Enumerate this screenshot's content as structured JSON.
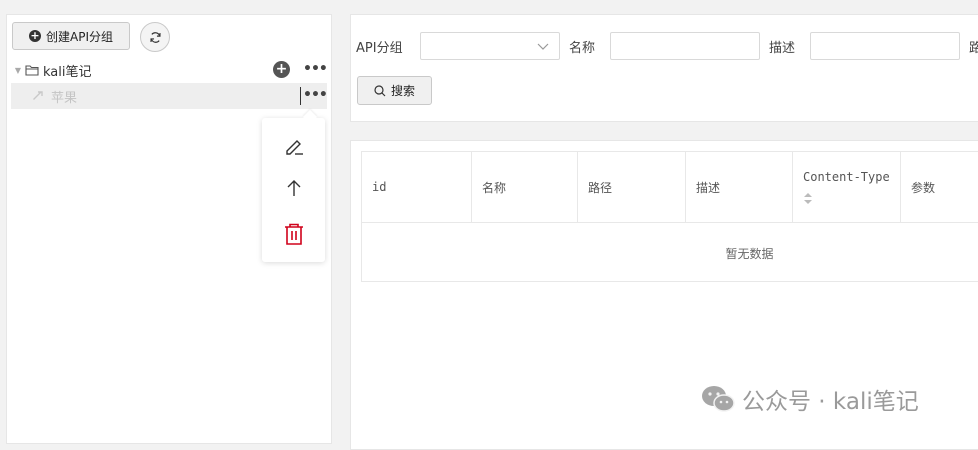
{
  "sidebar": {
    "create_label": "创建API分组",
    "tree": {
      "root_label": "kali笔记",
      "child_label": "苹果"
    },
    "menu_items": [
      "edit",
      "move-up",
      "delete"
    ]
  },
  "search": {
    "group_label": "API分组",
    "name_label": "名称",
    "desc_label": "描述",
    "path_label": "路",
    "button_label": "搜索"
  },
  "table": {
    "columns": [
      "id",
      "名称",
      "路径",
      "描述",
      "Content-Type",
      "参数"
    ],
    "empty_text": "暂无数据"
  },
  "watermark": {
    "text": "公众号 · kali笔记"
  },
  "colors": {
    "delete": "#d0021b",
    "border": "#e6e6e6"
  }
}
